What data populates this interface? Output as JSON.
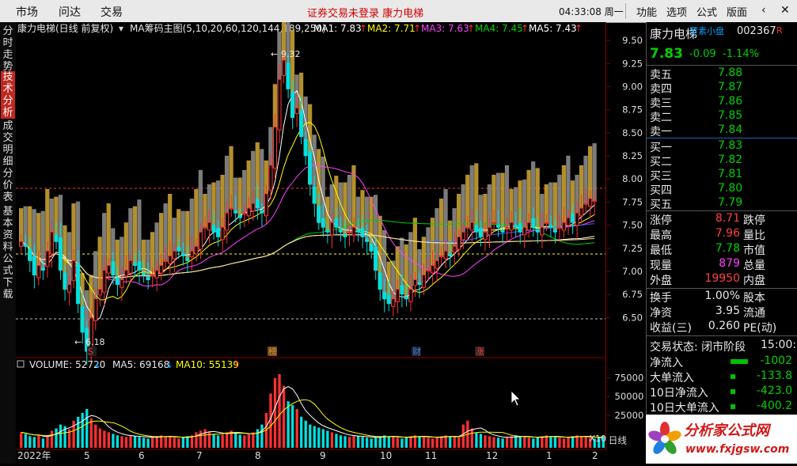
{
  "top_menu": [
    "市场",
    "问达",
    "交易"
  ],
  "notice": "证券交易未登录  康力电梯",
  "clock": "04:33:08 周一",
  "toolbar": [
    "功能",
    "选项",
    "公式",
    "版面"
  ],
  "toolbar_icons": [
    "chevron-left-icon",
    "close-icon"
  ],
  "left_tabs": [
    {
      "label": "分时走势",
      "active": false
    },
    {
      "label": "技术分析",
      "active": true
    },
    {
      "label": "成交明细",
      "active": false
    },
    {
      "label": "分价表",
      "active": false
    },
    {
      "label": "基本资料",
      "active": false
    },
    {
      "label": "公式下载",
      "active": false
    }
  ],
  "main_header": {
    "title": "康力电梯(日线 前复权)",
    "indicator": "MA筹码主图(5,10,20,60,120,144,189,250)",
    "ma": [
      {
        "label": "MA1: 7.83",
        "color": "#ffffff"
      },
      {
        "label": "MA2: 7.71",
        "color": "#ffff00"
      },
      {
        "label": "MA3: 7.63",
        "color": "#ff40ff"
      },
      {
        "label": "MA4: 7.45",
        "color": "#00d000"
      },
      {
        "label": "MA5: 7.43",
        "color": "#ffffff"
      }
    ],
    "up_arrow": "↑"
  },
  "vol_header": {
    "volume": "VOLUME: 52720",
    "ma5": "MA5: 69168",
    "ma10": "MA10: 55139",
    "down_arrow": "↓",
    "up_arrow": "↑"
  },
  "annotations": {
    "high": "9.32",
    "low": "6.18",
    "markers": [
      {
        "text": "S",
        "color": "#ff3030"
      },
      {
        "text": "榜",
        "color": "#d09040"
      },
      {
        "text": "财",
        "color": "#4080ff"
      },
      {
        "text": "涨",
        "color": "#ff4040"
      }
    ],
    "x10": "X10",
    "period": "日线"
  },
  "quote": {
    "name": "康力电梯",
    "sub": "罗素小盘",
    "code": "002367",
    "r_badge": "R",
    "price": "7.83",
    "change": "-0.09",
    "change_pct": "-1.14%",
    "asks": [
      {
        "label": "卖五",
        "price": "7.88"
      },
      {
        "label": "卖四",
        "price": "7.87"
      },
      {
        "label": "卖三",
        "price": "7.86"
      },
      {
        "label": "卖二",
        "price": "7.85"
      },
      {
        "label": "卖一",
        "price": "7.84"
      }
    ],
    "bids": [
      {
        "label": "买一",
        "price": "7.83"
      },
      {
        "label": "买二",
        "price": "7.82"
      },
      {
        "label": "买三",
        "price": "7.81"
      },
      {
        "label": "买四",
        "price": "7.80"
      },
      {
        "label": "买五",
        "price": "7.79"
      }
    ],
    "stats": [
      {
        "l1": "涨停",
        "v": "8.71",
        "c": "#ff4040",
        "l2": "跌停"
      },
      {
        "l1": "最高",
        "v": "7.96",
        "c": "#ff4040",
        "l2": "量比"
      },
      {
        "l1": "最低",
        "v": "7.78",
        "c": "#00d000",
        "l2": "市值"
      },
      {
        "l1": "现量",
        "v": "879",
        "c": "#ff40ff",
        "l2": "总量"
      },
      {
        "l1": "外盘",
        "v": "19950",
        "c": "#ff4040",
        "l2": "内盘"
      }
    ],
    "stats2": [
      {
        "l1": "换手",
        "v": "1.00%",
        "l2": "股本"
      },
      {
        "l1": "净资",
        "v": "3.95",
        "l2": "流通"
      },
      {
        "l1": "收益(三)",
        "v": "0.260",
        "l2": "PE(动)"
      }
    ],
    "trade_status": "交易状态: 闭市阶段",
    "trade_time": "15:00:",
    "flows": [
      {
        "label": "净流入",
        "value": "-1002"
      },
      {
        "label": "大单流入",
        "value": "-133.8"
      },
      {
        "label": "10日净流入",
        "value": "-423.0"
      },
      {
        "label": "10日大单流入",
        "value": "-400.2"
      }
    ]
  },
  "brand": {
    "cn": "分析家公式网",
    "url": "www.fxjgsw.com"
  },
  "chart_data": {
    "type": "candlestick",
    "title": "康力电梯(日线 前复权)",
    "y_ticks": [
      "9.50",
      "9.25",
      "9.00",
      "8.75",
      "8.50",
      "8.25",
      "8.00",
      "7.75",
      "7.50",
      "7.25",
      "7.00",
      "6.75",
      "6.50"
    ],
    "ylim": [
      6.3,
      9.55
    ],
    "vol_ticks": [
      "75000",
      "50000",
      "25000"
    ],
    "x_ticks": [
      "2022年",
      "5",
      "6",
      "7",
      "8",
      "9",
      "10",
      "11",
      "12",
      "1",
      "2"
    ],
    "close": [
      7.4,
      7.35,
      7.2,
      7.05,
      7.15,
      7.1,
      7.3,
      7.5,
      7.4,
      7.1,
      6.9,
      6.95,
      7.2,
      6.75,
      6.45,
      6.25,
      6.6,
      6.8,
      6.9,
      7.1,
      7.15,
      7.05,
      6.95,
      7.0,
      7.1,
      7.2,
      7.15,
      7.1,
      7.05,
      7.0,
      7.05,
      7.1,
      7.15,
      7.2,
      7.25,
      7.3,
      7.3,
      7.25,
      7.2,
      7.3,
      7.35,
      7.5,
      7.55,
      7.6,
      7.5,
      7.45,
      7.55,
      7.7,
      7.75,
      7.7,
      7.65,
      7.7,
      7.75,
      7.8,
      7.75,
      7.7,
      7.9,
      8.2,
      8.6,
      9.1,
      9.3,
      9.0,
      8.7,
      8.8,
      8.5,
      8.3,
      8.0,
      7.8,
      7.6,
      7.55,
      7.5,
      7.6,
      7.55,
      7.5,
      7.45,
      7.5,
      7.55,
      7.5,
      7.45,
      7.4,
      7.3,
      7.1,
      6.9,
      6.8,
      6.75,
      6.8,
      6.9,
      6.85,
      6.8,
      6.9,
      7.0,
      6.95,
      7.05,
      7.1,
      7.15,
      7.2,
      7.25,
      7.3,
      7.25,
      7.35,
      7.45,
      7.5,
      7.55,
      7.6,
      7.5,
      7.45,
      7.5,
      7.55,
      7.6,
      7.55,
      7.5,
      7.55,
      7.6,
      7.55,
      7.5,
      7.55,
      7.6,
      7.55,
      7.5,
      7.55,
      7.6,
      7.55,
      7.5,
      7.55,
      7.6,
      7.65,
      7.6,
      7.7,
      7.75,
      7.8,
      7.85,
      7.83
    ],
    "volume": [
      20,
      18,
      15,
      14,
      16,
      12,
      15,
      22,
      25,
      30,
      28,
      24,
      35,
      40,
      45,
      50,
      38,
      30,
      25,
      22,
      20,
      18,
      16,
      15,
      14,
      16,
      15,
      14,
      13,
      12,
      14,
      15,
      16,
      15,
      14,
      13,
      12,
      14,
      15,
      16,
      20,
      22,
      24,
      21,
      18,
      16,
      17,
      20,
      22,
      19,
      17,
      16,
      18,
      20,
      24,
      30,
      45,
      70,
      90,
      95,
      80,
      60,
      55,
      50,
      40,
      35,
      30,
      28,
      26,
      24,
      22,
      20,
      18,
      16,
      15,
      14,
      16,
      15,
      14,
      13,
      12,
      14,
      15,
      16,
      15,
      14,
      13,
      12,
      14,
      15,
      16,
      15,
      14,
      13,
      12,
      14,
      15,
      16,
      15,
      14,
      13,
      30,
      35,
      25,
      20,
      18,
      16,
      15,
      14,
      13,
      12,
      14,
      15,
      16,
      15,
      14,
      13,
      12,
      14,
      15,
      16,
      15,
      14,
      13,
      12,
      14,
      15,
      16,
      15,
      14,
      13,
      12,
      14,
      15
    ]
  }
}
